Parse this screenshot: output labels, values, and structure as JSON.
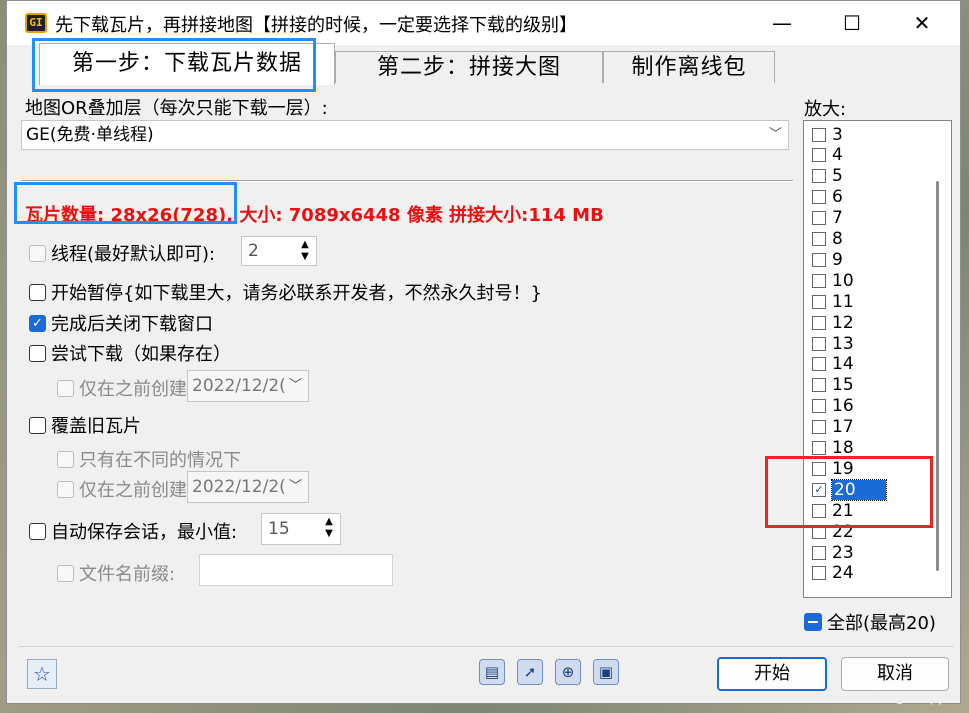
{
  "window": {
    "title": "先下载瓦片，再拼接地图【拼接的时候，一定要选择下载的级别】",
    "app_icon_text": "GI"
  },
  "tabs": [
    {
      "label": "第一步：下载瓦片数据"
    },
    {
      "label": "第二步：拼接大图"
    },
    {
      "label": "制作离线包"
    }
  ],
  "layer": {
    "label": "地图OR叠加层（每次只能下载一层）:",
    "selected": "GE(免费·单线程)"
  },
  "info": {
    "tile_count": "瓦片数量: 28x26(728),",
    "size": " 大小: 7089x6448 像素 拼接大小:114 MB"
  },
  "options": {
    "threads_label": "线程(最好默认即可):",
    "threads_value": "2",
    "pause_label": "开始暂停{如下载里大，请务必联系开发者，不然永久封号！}",
    "close_label": "完成后关闭下载窗口",
    "try_label": "尝试下载（如果存在）",
    "only_before_label": "仅在之前创建",
    "date1": "2022/12/2(",
    "overwrite_label": "覆盖旧瓦片",
    "only_diff_label": "只有在不同的情况下",
    "only_before_label2": "仅在之前创建",
    "date2": "2022/12/2(",
    "autosave_label": "自动保存会话，最小值:",
    "autosave_value": "15",
    "prefix_label": "文件名前缀:"
  },
  "zoom": {
    "label": "放大:",
    "levels": [
      "3",
      "4",
      "5",
      "6",
      "7",
      "8",
      "9",
      "10",
      "11",
      "12",
      "13",
      "14",
      "15",
      "16",
      "17",
      "18",
      "19",
      "20",
      "21",
      "22",
      "23",
      "24"
    ],
    "checked": "20",
    "all_label": "全部(最高20)"
  },
  "buttons": {
    "start": "开始",
    "cancel": "取消"
  },
  "watermark": "CSDN @sleepy-R"
}
